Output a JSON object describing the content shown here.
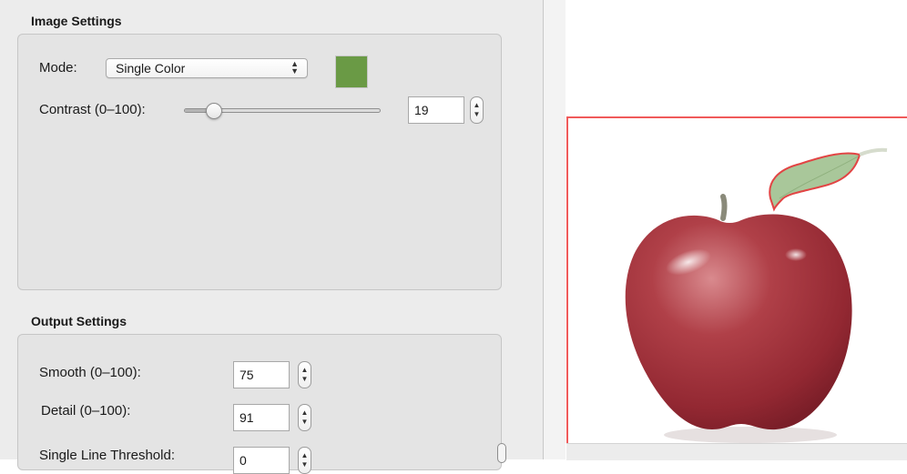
{
  "image_settings": {
    "title": "Image Settings",
    "mode_label": "Mode:",
    "mode_value": "Single Color",
    "swatch_color": "#6a9a45",
    "contrast_label": "Contrast (0–100):",
    "contrast_value": "19",
    "contrast_level": 0.12
  },
  "output_settings": {
    "title": "Output Settings",
    "smooth_label": "Smooth (0–100):",
    "smooth_value": "75",
    "detail_label": "Detail (0–100):",
    "detail_value": "91",
    "threshold_label": "Single Line Threshold:",
    "threshold_value": "0"
  },
  "preview": {
    "outline_color": "#f05a5a",
    "subject_icon": "apple-image"
  }
}
